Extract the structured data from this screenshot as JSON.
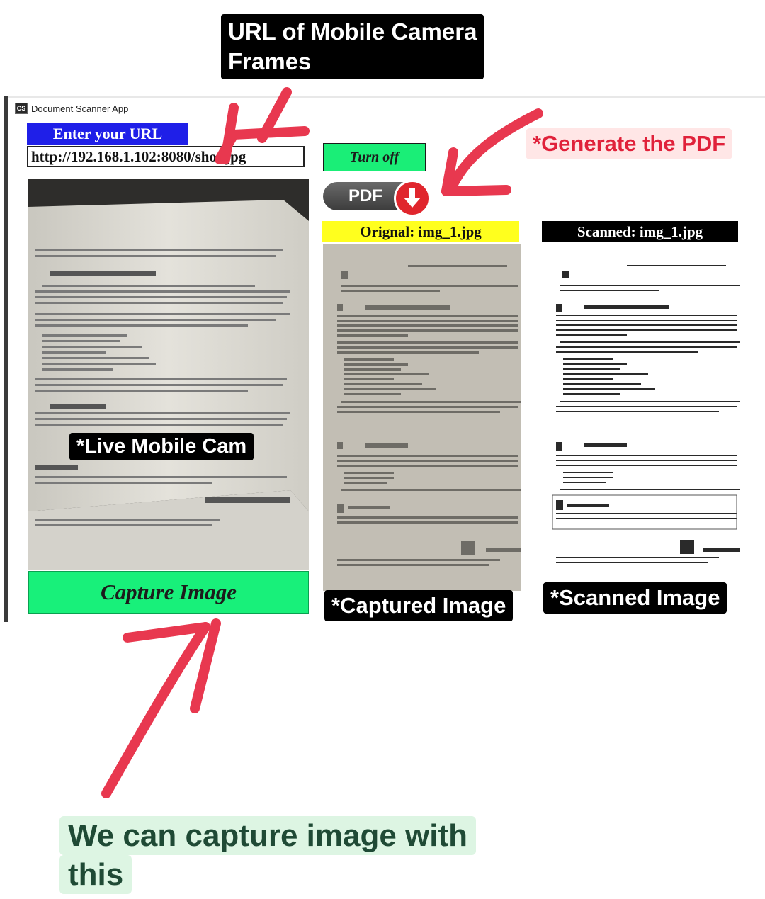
{
  "annotations": {
    "url_tag_line1": "URL of Mobile Camera",
    "url_tag_line2": "Frames",
    "generate_pdf": "*Generate the PDF",
    "live_cam": "*Live Mobile Cam",
    "captured_image": "*Captured Image",
    "scanned_image": "*Scanned Image",
    "bottom_line1": "We can capture image with",
    "bottom_line2": "this"
  },
  "window": {
    "title": "Document Scanner App",
    "icon_text": "CS"
  },
  "url_section": {
    "label": "Enter your URL",
    "value": "http://192.168.1.102:8080/shot.jpg"
  },
  "buttons": {
    "capture": "Capture Image",
    "turn_off": "Turn off",
    "pdf": "PDF"
  },
  "previews": {
    "original_label": "Orignal: img_1.jpg",
    "scanned_label": "Scanned: img_1.jpg"
  },
  "colors": {
    "annotation_arrow": "#e8384f",
    "url_label_bg": "#1f1fe8",
    "button_green": "#1aee77",
    "original_label_bg": "#ffff1e"
  },
  "icons": {
    "app": "app-icon",
    "pdf_download": "download-arrow-icon"
  }
}
